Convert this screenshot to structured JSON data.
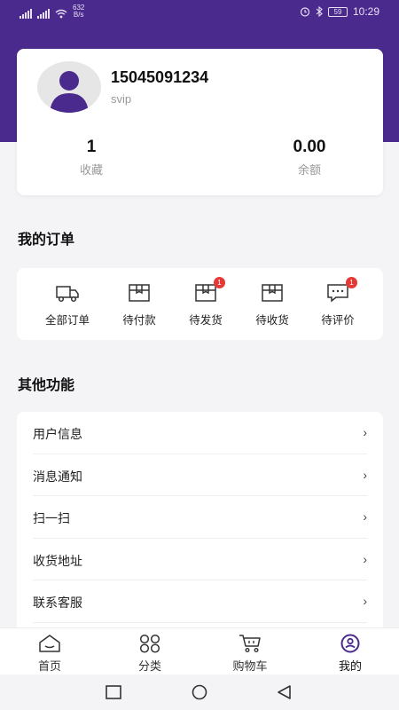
{
  "status_bar": {
    "speed_value": "632",
    "speed_unit": "B/s",
    "battery": "59",
    "time": "10:29"
  },
  "profile": {
    "phone": "15045091234",
    "level": "svip",
    "stats": [
      {
        "value": "1",
        "label": "收藏"
      },
      {
        "value": "0.00",
        "label": "余额"
      }
    ]
  },
  "orders": {
    "title": "我的订单",
    "items": [
      {
        "label": "全部订单",
        "icon": "truck-icon",
        "badge": ""
      },
      {
        "label": "待付款",
        "icon": "box-icon",
        "badge": ""
      },
      {
        "label": "待发货",
        "icon": "box-icon",
        "badge": "1"
      },
      {
        "label": "待收货",
        "icon": "box-icon",
        "badge": ""
      },
      {
        "label": "待评价",
        "icon": "chat-icon",
        "badge": "1"
      }
    ]
  },
  "functions": {
    "title": "其他功能",
    "items": [
      {
        "label": "用户信息"
      },
      {
        "label": "消息通知"
      },
      {
        "label": "扫一扫"
      },
      {
        "label": "收货地址"
      },
      {
        "label": "联系客服"
      }
    ]
  },
  "tabbar": {
    "items": [
      {
        "label": "首页",
        "icon": "home-icon"
      },
      {
        "label": "分类",
        "icon": "grid-icon"
      },
      {
        "label": "购物车",
        "icon": "cart-icon"
      },
      {
        "label": "我的",
        "icon": "user-icon",
        "active": true
      }
    ]
  },
  "colors": {
    "header_bg": "#4a2a8c",
    "badge": "#e53935",
    "accent": "#4a2a8c"
  }
}
